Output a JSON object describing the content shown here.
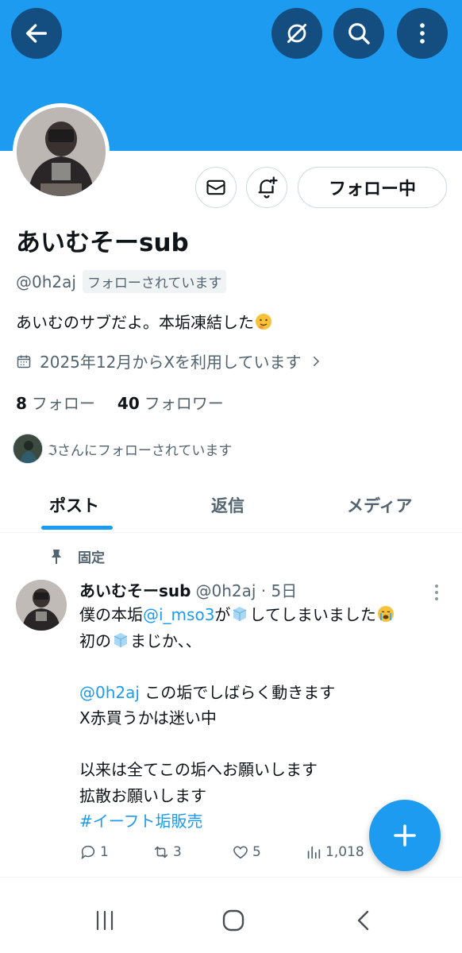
{
  "header": {
    "back_icon": "arrow-left-icon",
    "grok_icon": "slash-circle-icon",
    "search_icon": "search-icon",
    "more_icon": "more-vertical-icon",
    "banner_color": "#1d9bf0"
  },
  "profile": {
    "name": "あいむそーsub",
    "handle": "@0h2aj",
    "follows_you": "フォローされています",
    "bio": "あいむのサブだよ。本垢凍結した",
    "joined": "2025年12月からXを利用しています",
    "following_count": "8",
    "following_label": "フォロー",
    "followers_count": "40",
    "followers_label": "フォロワー",
    "followed_by": "ℑさんにフォローされています",
    "follow_button": "フォロー中"
  },
  "tabs": [
    {
      "label": "ポスト",
      "active": true
    },
    {
      "label": "返信",
      "active": false
    },
    {
      "label": "メディア",
      "active": false
    }
  ],
  "post": {
    "pinned_label": "固定",
    "name": "あいむそーsub",
    "handle_time": "@0h2aj · 5日",
    "line1_a": "僕の本垢",
    "line1_mention": "@i_mso3",
    "line1_b": "が",
    "line1_c": "してしまいました",
    "line2_a": "初の",
    "line2_b": "まじか、、",
    "line4_mention": "@0h2aj",
    "line4_b": " この垢でしばらく動きます",
    "line5": "X赤買うかは迷い中",
    "line7": "以来は全てこの垢へお願いします",
    "line8": "拡散お願いします",
    "hashtag": "#イーフト垢販売",
    "replies": "1",
    "reposts": "3",
    "likes": "5",
    "views": "1,018"
  },
  "fab_icon": "plus-icon",
  "accent": "#1d9bf0"
}
